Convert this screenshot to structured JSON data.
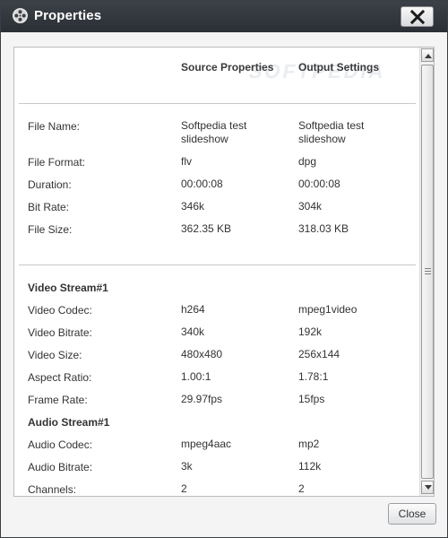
{
  "window": {
    "title": "Properties"
  },
  "header": {
    "source": "Source Properties",
    "output": "Output Settings",
    "watermark": "SOFTPEDIA"
  },
  "general": [
    {
      "label": "File Name:",
      "source": "Softpedia test slideshow",
      "output": "Softpedia test slideshow"
    },
    {
      "label": "File Format:",
      "source": "flv",
      "output": "dpg"
    },
    {
      "label": "Duration:",
      "source": "00:00:08",
      "output": "00:00:08"
    },
    {
      "label": "Bit Rate:",
      "source": "346k",
      "output": "304k"
    },
    {
      "label": "File Size:",
      "source": "362.35 KB",
      "output": "318.03 KB"
    }
  ],
  "video": {
    "title": "Video Stream#1",
    "rows": [
      {
        "label": "Video Codec:",
        "source": "h264",
        "output": "mpeg1video"
      },
      {
        "label": "Video Bitrate:",
        "source": "340k",
        "output": "192k"
      },
      {
        "label": "Video Size:",
        "source": "480x480",
        "output": "256x144"
      },
      {
        "label": "Aspect Ratio:",
        "source": "1.00:1",
        "output": "1.78:1"
      },
      {
        "label": "Frame Rate:",
        "source": "29.97fps",
        "output": "15fps"
      }
    ]
  },
  "audio": {
    "title": "Audio Stream#1",
    "rows": [
      {
        "label": "Audio Codec:",
        "source": "mpeg4aac",
        "output": "mp2"
      },
      {
        "label": "Audio Bitrate:",
        "source": "3k",
        "output": "112k"
      },
      {
        "label": "Channels:",
        "source": "2",
        "output": "2"
      }
    ]
  },
  "footer": {
    "close_label": "Close"
  },
  "icons": {
    "app": "film-reel-icon",
    "close": "close-icon"
  },
  "colors": {
    "titlebar": "#2f3339",
    "panel_border": "#b9bcc0"
  }
}
